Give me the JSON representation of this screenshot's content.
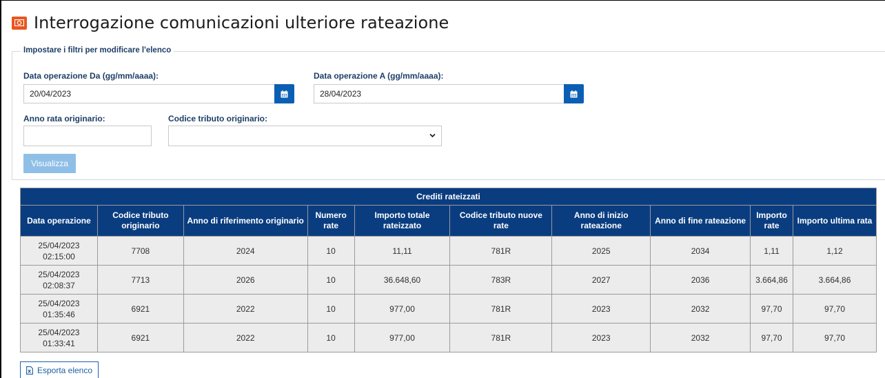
{
  "header": {
    "title": "Interrogazione comunicazioni ulteriore rateazione",
    "icon": "money-icon",
    "icon_color": "#e8561f"
  },
  "filters": {
    "legend": "Impostare i filtri per modificare l'elenco",
    "date_from_label": "Data operazione Da (gg/mm/aaaa):",
    "date_from_value": "20/04/2023",
    "date_to_label": "Data operazione A (gg/mm/aaaa):",
    "date_to_value": "28/04/2023",
    "anno_label": "Anno rata originario:",
    "anno_value": "",
    "codice_label": "Codice tributo originario:",
    "codice_value": "",
    "submit_label": "Visualizza"
  },
  "table": {
    "caption": "Crediti rateizzati",
    "columns": [
      "Data operazione",
      "Codice tributo originario",
      "Anno di riferimento originario",
      "Numero rate",
      "Importo totale rateizzato",
      "Codice tributo nuove rate",
      "Anno di inizio rateazione",
      "Anno di fine rateazione",
      "Importo rate",
      "Importo ultima rata"
    ],
    "rows": [
      [
        "25/04/2023 02:15:00",
        "7708",
        "2024",
        "10",
        "11,11",
        "781R",
        "2025",
        "2034",
        "1,11",
        "1,12"
      ],
      [
        "25/04/2023 02:08:37",
        "7713",
        "2026",
        "10",
        "36.648,60",
        "783R",
        "2027",
        "2036",
        "3.664,86",
        "3.664,86"
      ],
      [
        "25/04/2023 01:35:46",
        "6921",
        "2022",
        "10",
        "977,00",
        "781R",
        "2023",
        "2032",
        "97,70",
        "97,70"
      ],
      [
        "25/04/2023 01:33:41",
        "6921",
        "2022",
        "10",
        "977,00",
        "781R",
        "2023",
        "2032",
        "97,70",
        "97,70"
      ]
    ]
  },
  "export": {
    "label": "Esporta elenco",
    "icon": "excel-file-icon"
  }
}
